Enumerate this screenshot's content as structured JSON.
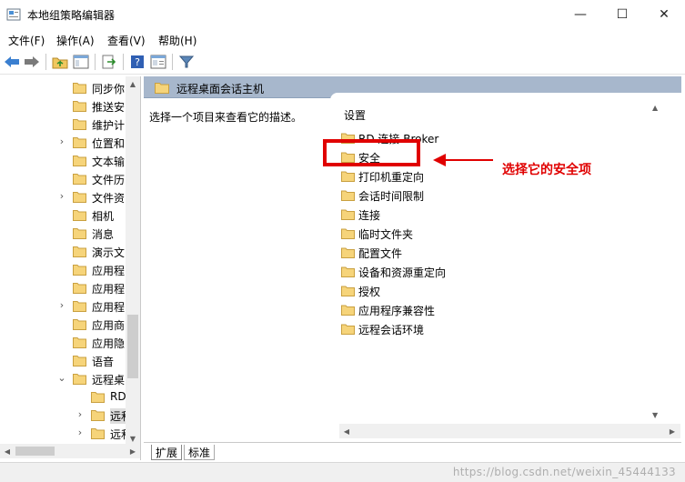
{
  "window": {
    "title": "本地组策略编辑器",
    "minimize_glyph": "—",
    "maximize_glyph": "☐",
    "close_glyph": "✕"
  },
  "menu": [
    {
      "label": "文件(F)"
    },
    {
      "label": "操作(A)"
    },
    {
      "label": "查看(V)"
    },
    {
      "label": "帮助(H)"
    }
  ],
  "toolbar": {
    "icons": [
      "back-arrow-icon",
      "forward-arrow-icon",
      "up-folder-icon",
      "show-hide-tree-icon",
      "export-list-icon",
      "help-icon",
      "properties-icon",
      "filter-icon"
    ]
  },
  "tree": {
    "items": [
      {
        "label": "同步你",
        "chevron": ""
      },
      {
        "label": "推送安",
        "chevron": ""
      },
      {
        "label": "维护计",
        "chevron": ""
      },
      {
        "label": "位置和",
        "chevron": "›"
      },
      {
        "label": "文本输",
        "chevron": ""
      },
      {
        "label": "文件历",
        "chevron": ""
      },
      {
        "label": "文件资",
        "chevron": "›"
      },
      {
        "label": "相机",
        "chevron": ""
      },
      {
        "label": "消息",
        "chevron": ""
      },
      {
        "label": "演示文",
        "chevron": ""
      },
      {
        "label": "应用程",
        "chevron": ""
      },
      {
        "label": "应用程",
        "chevron": ""
      },
      {
        "label": "应用程",
        "chevron": "›"
      },
      {
        "label": "应用商",
        "chevron": ""
      },
      {
        "label": "应用隐",
        "chevron": ""
      },
      {
        "label": "语音",
        "chevron": ""
      },
      {
        "label": "远程桌",
        "chevron": "⌄"
      },
      {
        "label": "RD",
        "chevron": ""
      },
      {
        "label": "远和",
        "chevron": "›"
      },
      {
        "label": "远和",
        "chevron": "›"
      }
    ]
  },
  "right_pane": {
    "header_title": "远程桌面会话主机",
    "description": "选择一个项目来查看它的描述。",
    "column_header": "设置",
    "items": [
      {
        "label": "RD 连接 Broker"
      },
      {
        "label": "安全"
      },
      {
        "label": "打印机重定向"
      },
      {
        "label": "会话时间限制"
      },
      {
        "label": "连接"
      },
      {
        "label": "临时文件夹"
      },
      {
        "label": "配置文件"
      },
      {
        "label": "设备和资源重定向"
      },
      {
        "label": "授权"
      },
      {
        "label": "应用程序兼容性"
      },
      {
        "label": "远程会话环境"
      }
    ]
  },
  "tabs": [
    {
      "label": "扩展",
      "active": true
    },
    {
      "label": "标准",
      "active": false
    }
  ],
  "annotation": {
    "text": "选择它的安全项",
    "color": "#e00000"
  },
  "watermark": "https://blog.csdn.net/weixin_45444133",
  "colors": {
    "folder": "#f0c75e",
    "header_bg": "#a7b7cc",
    "annotation": "#e00000"
  }
}
